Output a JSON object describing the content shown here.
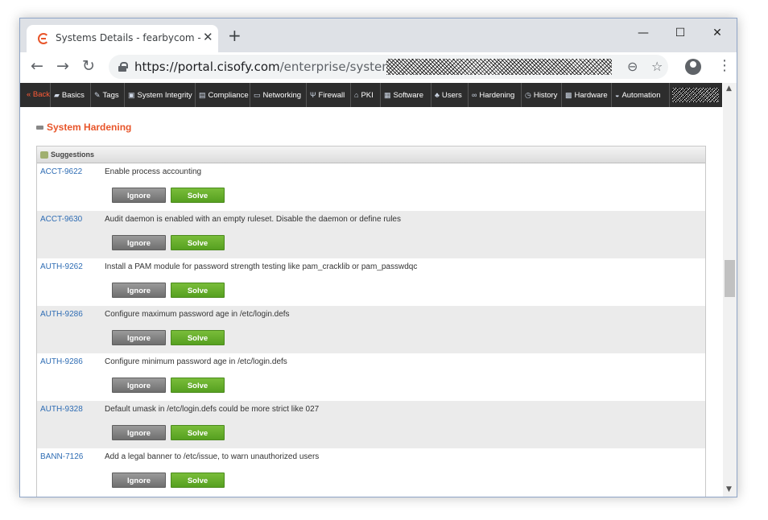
{
  "browser": {
    "tab_title": "Systems Details - fearbycom - Ly",
    "tab_close": "✕",
    "new_tab": "+",
    "url_host": "https://portal.cisofy.com",
    "url_path": "/enterprise/system/details",
    "back": "←",
    "forward": "→",
    "reload": "↻",
    "zoom": "⊖",
    "star": "☆",
    "menu": "⋮",
    "minimize": "—",
    "maximize": "☐",
    "close": "✕"
  },
  "navbar": {
    "items": [
      {
        "label": "« Back",
        "icon": ""
      },
      {
        "label": "Basics",
        "icon": "▰"
      },
      {
        "label": "Tags",
        "icon": "✎"
      },
      {
        "label": "System Integrity",
        "icon": "▣"
      },
      {
        "label": "Compliance",
        "icon": "▤"
      },
      {
        "label": "Networking",
        "icon": "▭"
      },
      {
        "label": "Firewall",
        "icon": "Ψ"
      },
      {
        "label": "PKI",
        "icon": "⌂"
      },
      {
        "label": "Software",
        "icon": "▦"
      },
      {
        "label": "Users",
        "icon": "♣"
      },
      {
        "label": "Hardening",
        "icon": "∞"
      },
      {
        "label": "History",
        "icon": "◷"
      },
      {
        "label": "Hardware",
        "icon": "▩"
      },
      {
        "label": "Automation",
        "icon": "◒"
      }
    ]
  },
  "section": {
    "title": "System Hardening"
  },
  "panel": {
    "header": "Suggestions",
    "ignore_label": "Ignore",
    "solve_label": "Solve",
    "rows": [
      {
        "id": "ACCT-9622",
        "desc": "Enable process accounting"
      },
      {
        "id": "ACCT-9630",
        "desc": "Audit daemon is enabled with an empty ruleset. Disable the daemon or define rules"
      },
      {
        "id": "AUTH-9262",
        "desc": "Install a PAM module for password strength testing like pam_cracklib or pam_passwdqc"
      },
      {
        "id": "AUTH-9286",
        "desc": "Configure maximum password age in /etc/login.defs"
      },
      {
        "id": "AUTH-9286",
        "desc": "Configure minimum password age in /etc/login.defs"
      },
      {
        "id": "AUTH-9328",
        "desc": "Default umask in /etc/login.defs could be more strict like 027"
      },
      {
        "id": "BANN-7126",
        "desc": "Add a legal banner to /etc/issue, to warn unauthorized users"
      }
    ]
  },
  "colors": {
    "accent": "#e8552a",
    "link": "#2f6db4",
    "solve": "#5fac28",
    "ignore": "#7f7f7f",
    "navbar": "#2d2d2d"
  }
}
